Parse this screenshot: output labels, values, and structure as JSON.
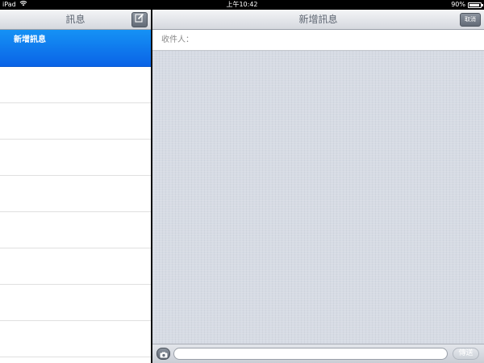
{
  "status_bar": {
    "device": "iPad",
    "time": "上午10:42",
    "battery": "90%",
    "battery_level": 0.9,
    "wifi_icon": "wifi-icon",
    "battery_icon": "battery-icon"
  },
  "sidebar": {
    "title": "訊息",
    "compose_icon": "compose-icon",
    "items": [
      {
        "label": "新增訊息",
        "selected": true
      },
      {
        "label": ""
      },
      {
        "label": ""
      },
      {
        "label": ""
      },
      {
        "label": ""
      },
      {
        "label": ""
      },
      {
        "label": ""
      },
      {
        "label": ""
      },
      {
        "label": ""
      }
    ]
  },
  "compose": {
    "title": "新增訊息",
    "cancel_label": "取消",
    "to_label": "收件人：",
    "camera_icon": "camera-icon",
    "message_value": "",
    "send_label": "傳送"
  },
  "colors": {
    "selection": "#0a63e6",
    "background": "#d6dbe4"
  }
}
